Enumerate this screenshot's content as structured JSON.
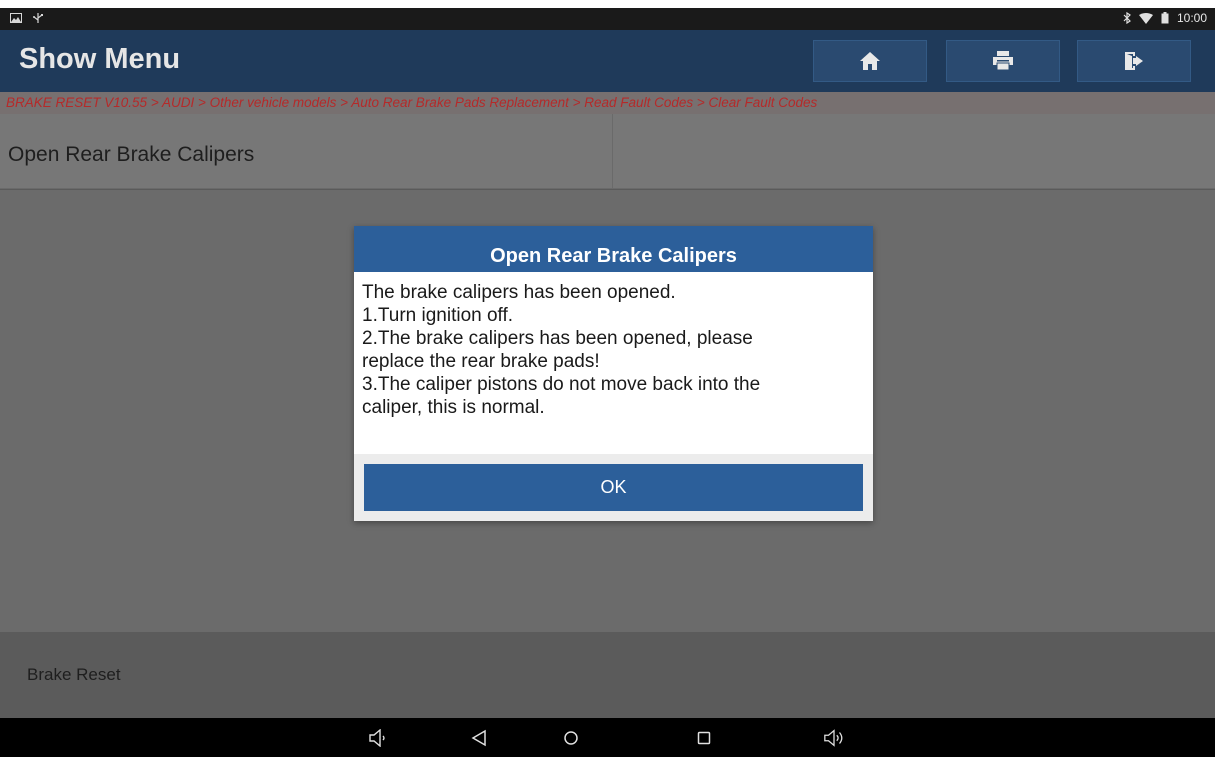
{
  "status_bar": {
    "time": "10:00",
    "icons": [
      "image-icon",
      "usb-icon",
      "bluetooth-icon",
      "wifi-icon",
      "battery-icon"
    ]
  },
  "header": {
    "title": "Show Menu",
    "buttons": [
      {
        "name": "home",
        "icon": "home-icon"
      },
      {
        "name": "print",
        "icon": "print-icon"
      },
      {
        "name": "exit",
        "icon": "exit-icon"
      }
    ]
  },
  "breadcrumb": {
    "text": "BRAKE RESET V10.55 > AUDI > Other vehicle models > Auto Rear Brake Pads Replacement > Read Fault Codes > Clear Fault Codes"
  },
  "section": {
    "title": "Open Rear Brake Calipers"
  },
  "dialog": {
    "title": "Open Rear Brake Calipers",
    "lines": [
      "The brake calipers has been opened.",
      "1.Turn ignition off.",
      "2.The brake calipers has been opened, please",
      "replace the rear brake pads!",
      "3.The caliper pistons do not move back into the",
      "caliper, this is normal."
    ],
    "ok_label": "OK"
  },
  "footer": {
    "label": "Brake Reset"
  },
  "nav_bar": {
    "icons": [
      "volume-down-icon",
      "back-icon",
      "home-circle-icon",
      "recents-icon",
      "volume-up-icon"
    ]
  },
  "colors": {
    "title_bar": "#1f3a5a",
    "dialog_accent": "#2c5f9a",
    "breadcrumb_text": "#b52a2a"
  }
}
